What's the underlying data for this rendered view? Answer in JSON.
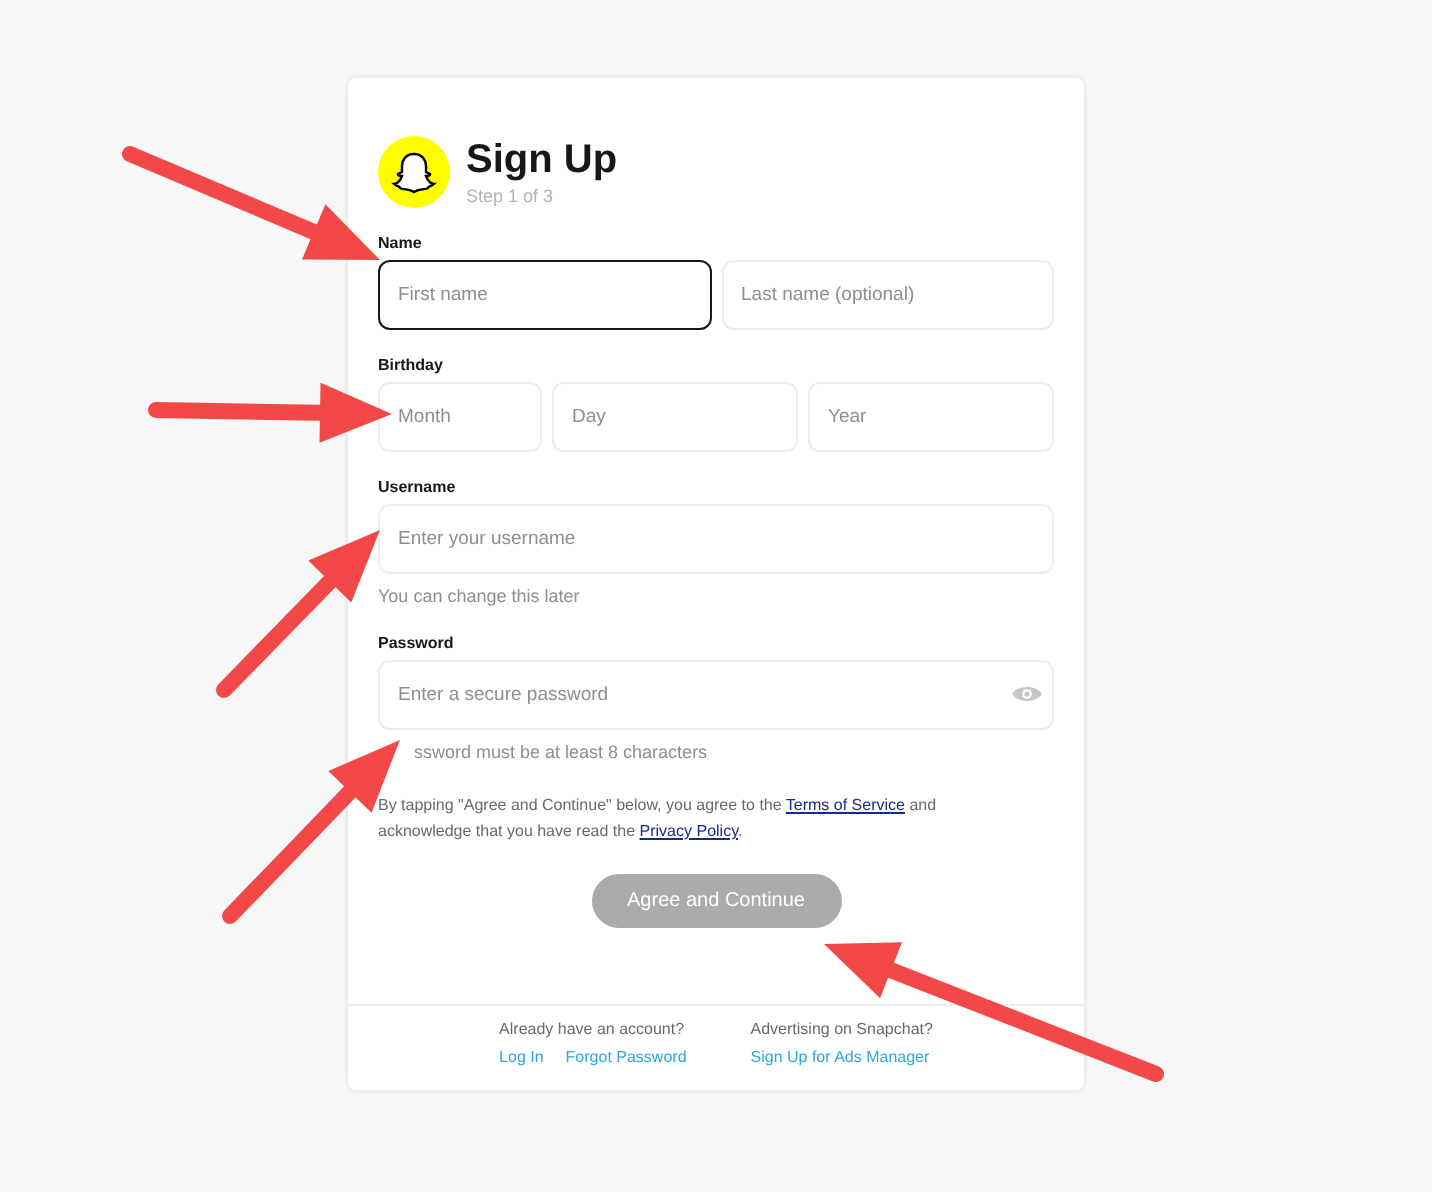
{
  "header": {
    "title": "Sign Up",
    "subtitle": "Step 1 of 3"
  },
  "sections": [
    {
      "kind": "name",
      "label": "Name",
      "fields": [
        {
          "placeholder": "First name",
          "focused": true
        },
        {
          "placeholder": "Last name (optional)",
          "focused": false
        }
      ]
    },
    {
      "kind": "birthday",
      "label": "Birthday",
      "fields": [
        {
          "placeholder": "Month",
          "focused": false
        },
        {
          "placeholder": "Day",
          "focused": false
        },
        {
          "placeholder": "Year",
          "focused": false
        }
      ]
    },
    {
      "kind": "username",
      "label": "Username",
      "fields": [
        {
          "placeholder": "Enter your username",
          "focused": false
        }
      ],
      "hint": "You can change this later"
    },
    {
      "kind": "password",
      "label": "Password",
      "fields": [
        {
          "placeholder": "Enter a secure password",
          "focused": false,
          "reveal": true
        }
      ],
      "hint": "ssword must be at least 8 characters"
    }
  ],
  "terms": {
    "before": "By tapping \"Agree and Continue\" below, you agree to the",
    "link1": "Terms of Service",
    "middle": "and acknowledge that you have read the",
    "link2": "Privacy Policy",
    "after": "."
  },
  "submit": {
    "label": "Agree and Continue",
    "disabled": true
  },
  "footer": [
    {
      "question": "Already have an account?",
      "links": [
        "Log In",
        "Forgot Password"
      ]
    },
    {
      "question": "Advertising on Snapchat?",
      "links": [
        "Sign Up for Ads Manager"
      ]
    }
  ]
}
